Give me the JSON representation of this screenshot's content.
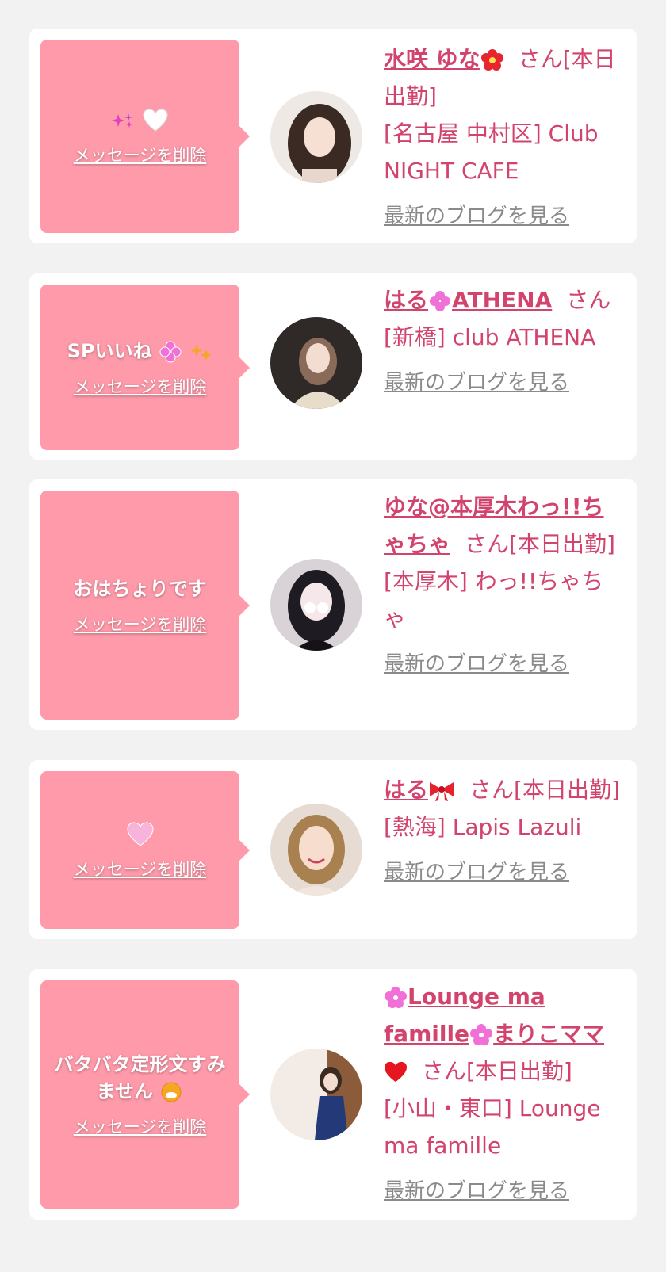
{
  "items": [
    {
      "bubble_message": "",
      "bubble_delete": "メッセージを削除",
      "name": "水咲 ゆな",
      "suffix": "さん[本日出勤]",
      "shop": "[名古屋 中村区] Club NIGHT CAFE",
      "blog_link": "最新のブログを見る"
    },
    {
      "bubble_message": "SPいいね",
      "bubble_delete": "メッセージを削除",
      "name": "はる",
      "name_tail": "ATHENA",
      "suffix": "さん",
      "shop": "[新橋] club ATHENA",
      "blog_link": "最新のブログを見る"
    },
    {
      "bubble_message": "おはちょりです",
      "bubble_delete": "メッセージを削除",
      "name": "ゆな@本厚木わっ!!ちゃちゃ",
      "suffix": "さん[本日出勤]",
      "shop": "[本厚木] わっ!!ちゃちゃ",
      "blog_link": "最新のブログを見る"
    },
    {
      "bubble_message": "",
      "bubble_delete": "メッセージを削除",
      "name": "はる",
      "suffix": "さん[本日出勤]",
      "shop": "[熱海] Lapis Lazuli",
      "blog_link": "最新のブログを見る"
    },
    {
      "bubble_message": "バタバタ定形文すみません",
      "bubble_delete": "メッセージを削除",
      "name_part1": "Lounge ma famille",
      "name_part2": "まりこママ",
      "suffix": "さん[本日出勤]",
      "shop": "[小山・東口] Lounge ma famille",
      "blog_link": "最新のブログを見る"
    }
  ],
  "colors": {
    "accent": "#d2446d",
    "bubble": "#ff9aaa",
    "page_bg": "#f2f2f2",
    "link_gray": "#8a8a8a"
  }
}
